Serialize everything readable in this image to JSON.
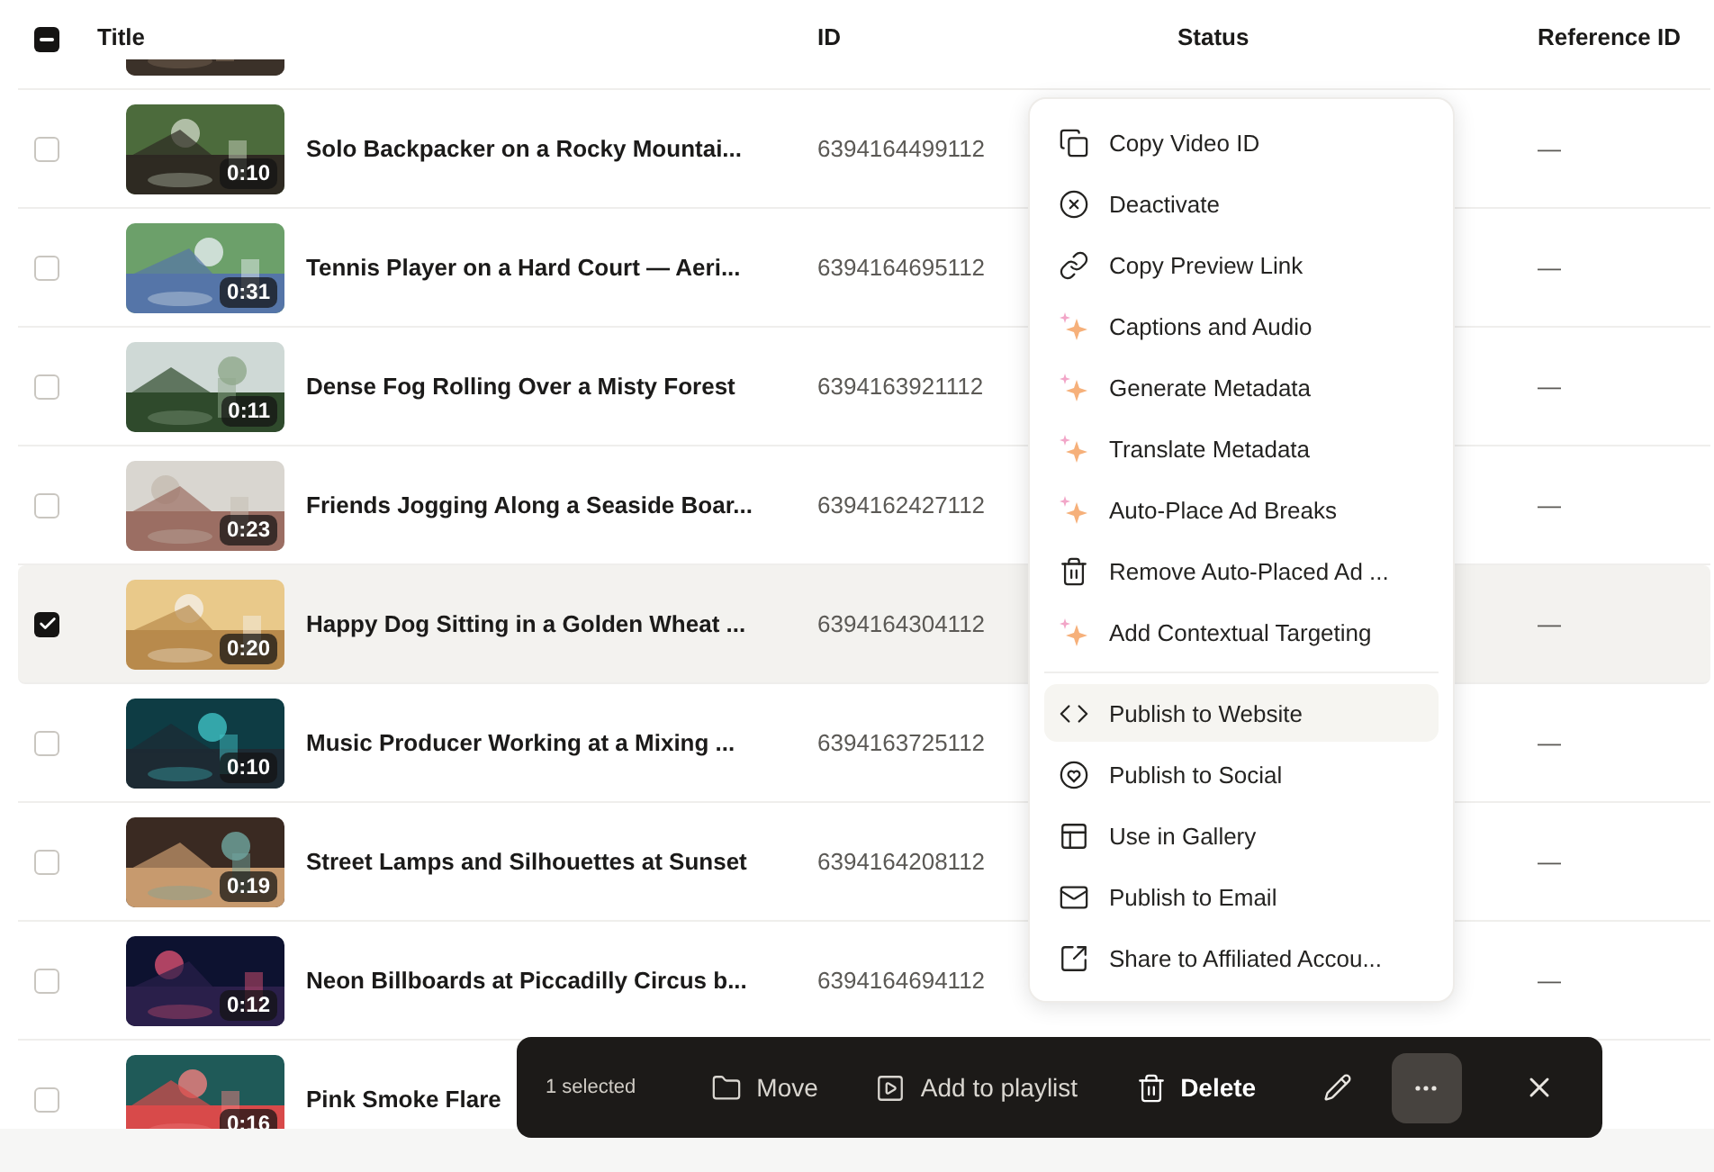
{
  "table": {
    "select_all": {
      "checked": true,
      "indeterminate": true
    },
    "columns": [
      "Title",
      "ID",
      "Status",
      "Reference ID"
    ],
    "rows": [
      {
        "kind": "partial"
      },
      {
        "kind": "full",
        "title": "Solo Backpacker on a Rocky Mountai...",
        "id": "6394164499112",
        "duration": "0:10",
        "reference": "—",
        "checked": false
      },
      {
        "kind": "full",
        "title": "Tennis Player on a Hard Court — Aeri...",
        "id": "6394164695112",
        "duration": "0:31",
        "reference": "—",
        "checked": false
      },
      {
        "kind": "full",
        "title": "Dense Fog Rolling Over a Misty Forest",
        "id": "6394163921112",
        "duration": "0:11",
        "reference": "—",
        "checked": false
      },
      {
        "kind": "full",
        "title": "Friends Jogging Along a Seaside Boar...",
        "id": "6394162427112",
        "duration": "0:23",
        "reference": "—",
        "checked": false
      },
      {
        "kind": "full",
        "title": "Happy Dog Sitting in a Golden Wheat ...",
        "id": "6394164304112",
        "duration": "0:20",
        "reference": "—",
        "checked": true
      },
      {
        "kind": "full",
        "title": "Music Producer Working at a Mixing ...",
        "id": "6394163725112",
        "duration": "0:10",
        "reference": "—",
        "checked": false
      },
      {
        "kind": "full",
        "title": "Street Lamps and Silhouettes at Sunset",
        "id": "6394164208112",
        "duration": "0:19",
        "reference": "—",
        "checked": false
      },
      {
        "kind": "full",
        "title": "Neon Billboards at Piccadilly Circus b...",
        "id": "6394164694112",
        "duration": "0:12",
        "reference": "—",
        "checked": false
      },
      {
        "kind": "full",
        "title": "Pink Smoke Flare",
        "duration": "0:16",
        "checked": false
      }
    ]
  },
  "context_menu": {
    "groups": [
      [
        {
          "label": "Copy Video ID",
          "selected": false
        },
        {
          "label": "Deactivate",
          "selected": false
        },
        {
          "label": "Copy Preview Link",
          "selected": false
        },
        {
          "label": "Captions and Audio",
          "selected": false
        },
        {
          "label": "Generate Metadata",
          "selected": false
        },
        {
          "label": "Translate Metadata",
          "selected": false
        },
        {
          "label": "Auto-Place Ad Breaks",
          "selected": false
        },
        {
          "label": "Remove Auto-Placed Ad ...",
          "selected": false
        },
        {
          "label": "Add Contextual Targeting",
          "selected": false
        }
      ],
      [
        {
          "label": "Publish to Website",
          "selected": true
        },
        {
          "label": "Publish to Social",
          "selected": false
        },
        {
          "label": "Use in Gallery",
          "selected": false
        },
        {
          "label": "Publish to Email",
          "selected": false
        },
        {
          "label": "Share to Affiliated Accou...",
          "selected": false
        }
      ]
    ]
  },
  "action_bar": {
    "selection_count": "1 selected",
    "actions": [
      {
        "label": "Move",
        "emphasis": false
      },
      {
        "label": "Add to playlist",
        "emphasis": false
      },
      {
        "label": "Delete",
        "emphasis": true
      }
    ],
    "more_button": {
      "active": true
    }
  }
}
